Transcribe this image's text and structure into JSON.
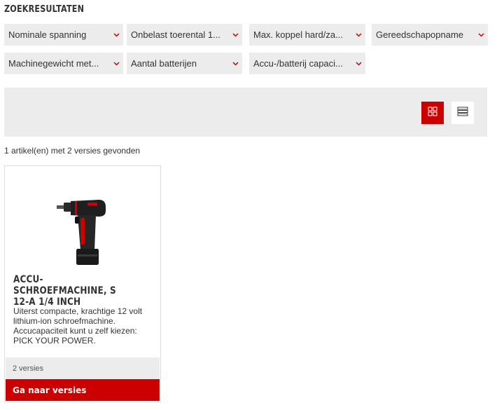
{
  "page": {
    "title": "ZOEKRESULTATEN"
  },
  "filters": [
    {
      "label": "Nominale spanning"
    },
    {
      "label": "Onbelast toerental 1..."
    },
    {
      "label": "Max. koppel hard/za..."
    },
    {
      "label": "Gereedschapopname"
    },
    {
      "label": "Machinegewicht met..."
    },
    {
      "label": "Aantal batterijen"
    },
    {
      "label": "Accu-/batterij capaci..."
    }
  ],
  "view_toggle": {
    "active": "grid",
    "icons": [
      "grid-view-icon",
      "list-view-icon"
    ]
  },
  "results": {
    "count_text": "1 artikel(en) met 2 versies gevonden"
  },
  "products": [
    {
      "title": "ACCU-SCHROEFMACHINE, S 12-A 1/4 INCH",
      "description": "Uiterst compacte, krachtige 12 volt lithium-ion schroefmachine. Accucapaciteit kunt u zelf kiezen: PICK YOUR POWER.",
      "versions_label": "2 versies",
      "cta_label": "Ga naar versies"
    }
  ],
  "colors": {
    "accent": "#cc0000",
    "panel": "#ececec",
    "text": "#333333"
  }
}
